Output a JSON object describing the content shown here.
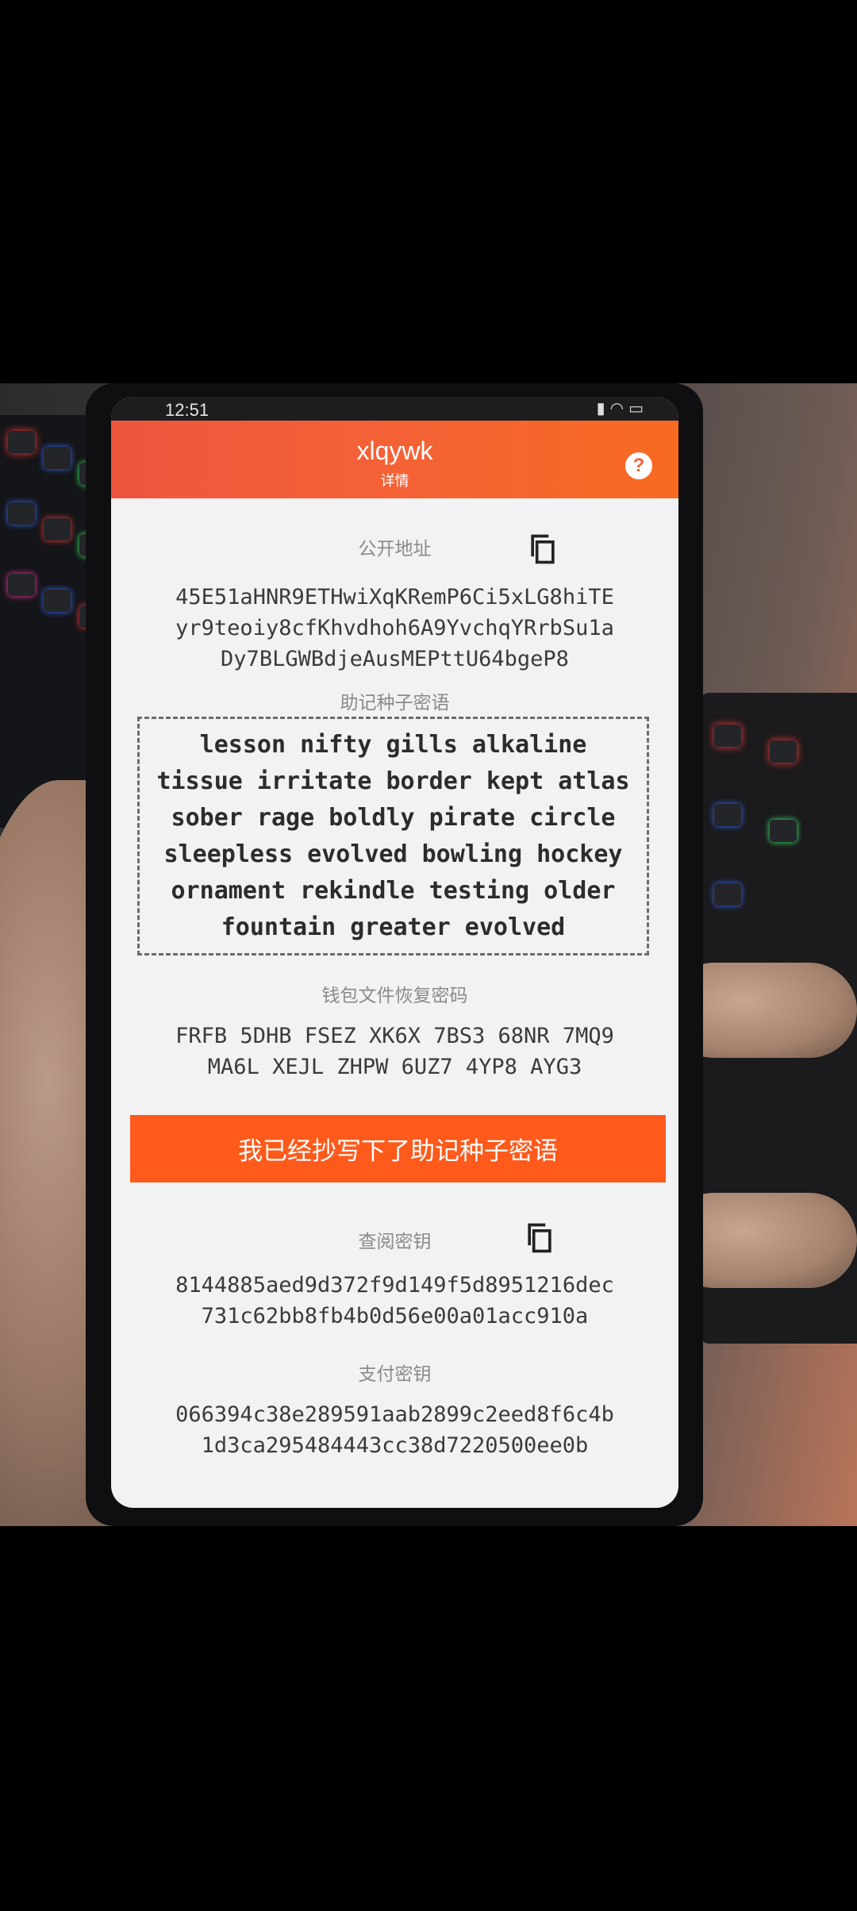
{
  "statusbar": {
    "time": "12:51",
    "icons": [
      "signal-icon",
      "wifi-icon",
      "battery-icon"
    ]
  },
  "header": {
    "title": "xlqywk",
    "subtitle": "详情",
    "help": "?"
  },
  "public_address": {
    "label": "公开地址",
    "lines": [
      "45E51aHNR9ETHwiXqKRemP6Ci5xLG8hiTE",
      "yr9teoiy8cfKhvdhoh6A9YvchqYRrbSu1a",
      "Dy7BLGWBdjeAusMEPttU64bgeP8"
    ]
  },
  "mnemonic": {
    "label": "助记种子密语",
    "lines": [
      "lesson nifty gills alkaline",
      "tissue irritate border kept atlas",
      "sober rage boldly pirate circle",
      "sleepless evolved bowling hockey",
      "ornament rekindle testing older",
      "fountain greater evolved"
    ]
  },
  "wallet_recovery": {
    "label": "钱包文件恢复密码",
    "lines": [
      "FRFB 5DHB FSEZ XK6X 7BS3 68NR 7MQ9",
      "MA6L XEJL ZHPW 6UZ7 4YP8 AYG3"
    ]
  },
  "confirm_button": "我已经抄写下了助记种子密语",
  "view_key": {
    "label": "查阅密钥",
    "lines": [
      "8144885aed9d372f9d149f5d8951216dec",
      "731c62bb8fb4b0d56e00a01acc910a"
    ]
  },
  "spend_key": {
    "label": "支付密钥",
    "lines": [
      "066394c38e289591aab2899c2eed8f6c4b",
      "1d3ca295484443cc38d7220500ee0b"
    ]
  },
  "colors": {
    "accent": "#fd5a1c",
    "header_start": "#f0553e",
    "header_end": "#f86a22",
    "background": "#f2f2f4"
  }
}
